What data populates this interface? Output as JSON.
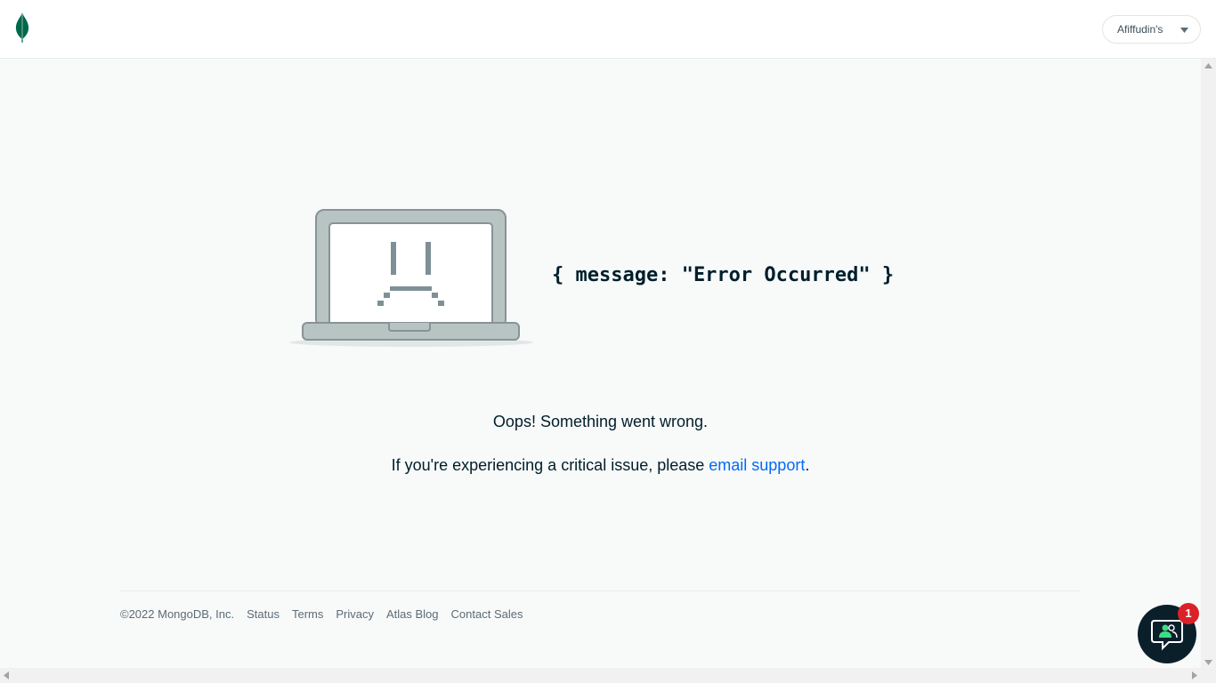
{
  "header": {
    "logo": "mongodb-leaf-logo",
    "org_select": {
      "label": "Afiffudin's",
      "icon": "caret-down-icon"
    }
  },
  "error": {
    "illustration": "sad-laptop-illustration",
    "code_message": "{ message: \"Error Occurred\" }",
    "heading": "Oops! Something went wrong.",
    "critical_prefix": "If you're experiencing a critical issue, please ",
    "support_link": "email support",
    "critical_suffix": "."
  },
  "footer": {
    "copyright": "©2022 MongoDB, Inc.",
    "links": [
      "Status",
      "Terms",
      "Privacy",
      "Atlas Blog",
      "Contact Sales"
    ]
  },
  "chat_widget": {
    "icon": "chat-support-icon",
    "badge_count": "1"
  },
  "colors": {
    "brand_green": "#00684a",
    "link_blue": "#016bf8",
    "badge_red": "#db2128",
    "chat_bg": "#0b1f2b"
  }
}
